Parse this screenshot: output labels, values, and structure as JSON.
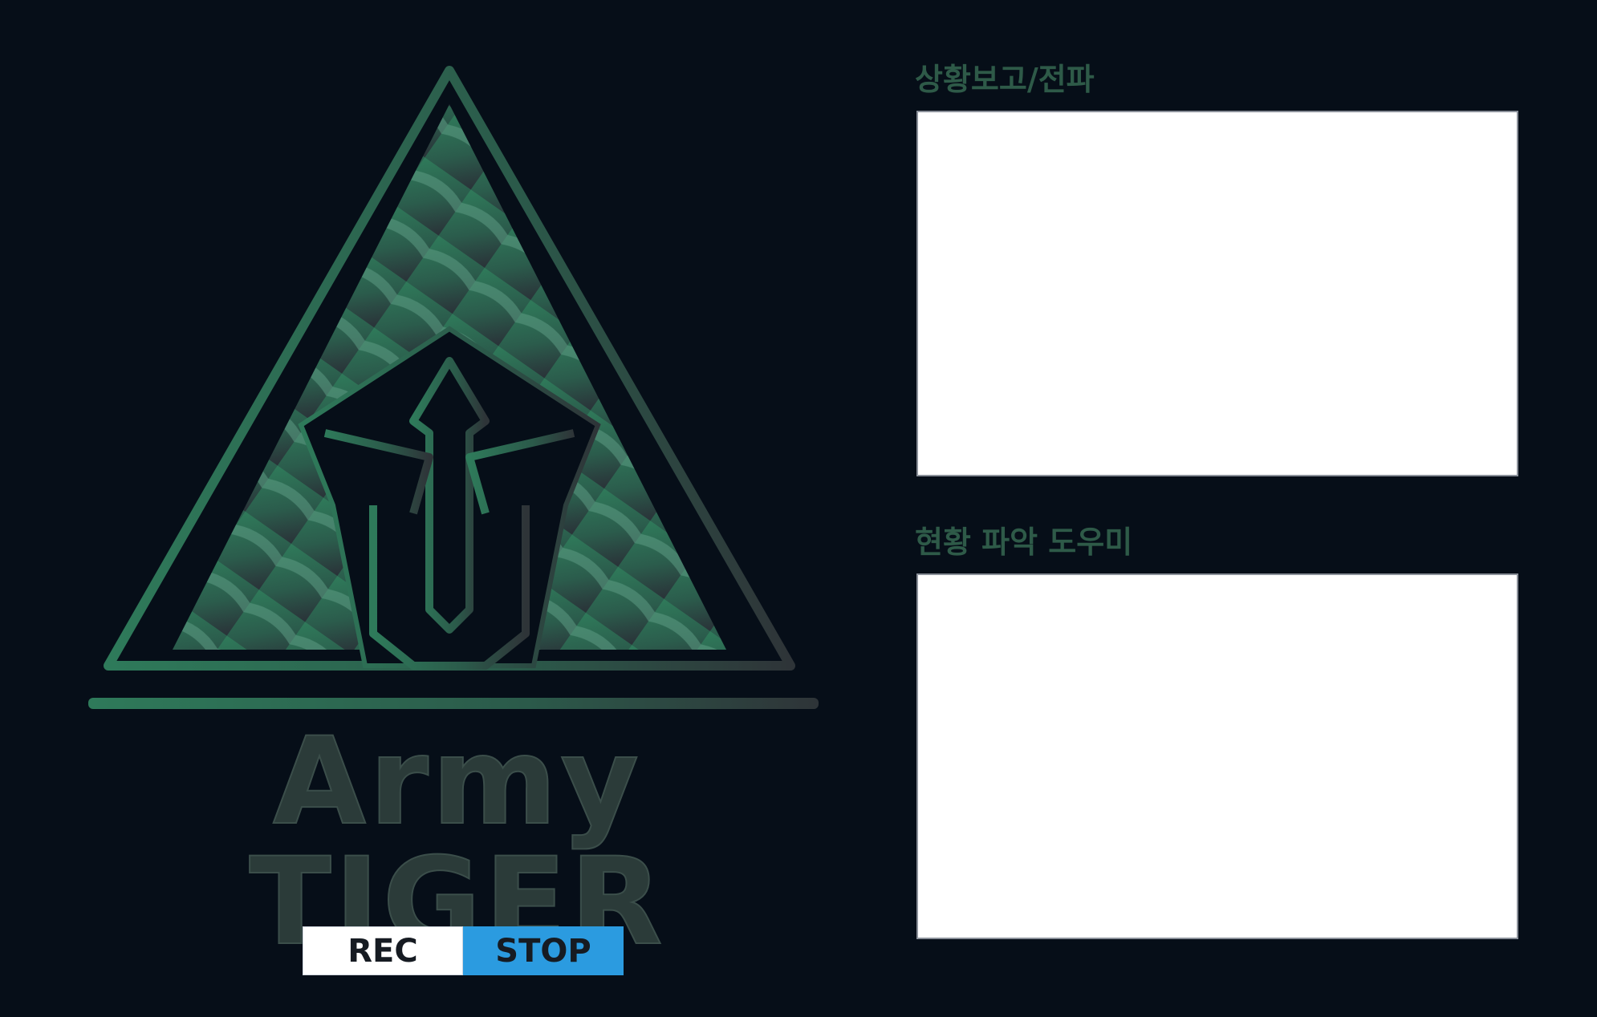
{
  "logo": {
    "wordmark": "Army TIGER",
    "icon": "army-tiger-emblem"
  },
  "controls": {
    "rec_label": "REC",
    "stop_label": "STOP"
  },
  "panels": [
    {
      "title": "상황보고/전파",
      "content": ""
    },
    {
      "title": "현황 파악 도우미",
      "content": ""
    }
  ],
  "colors": {
    "background": "#060e18",
    "brand_green": "#2e6b55",
    "title_green": "#2e5a48",
    "stop_button": "#2b9be0",
    "rec_button": "#ffffff"
  }
}
